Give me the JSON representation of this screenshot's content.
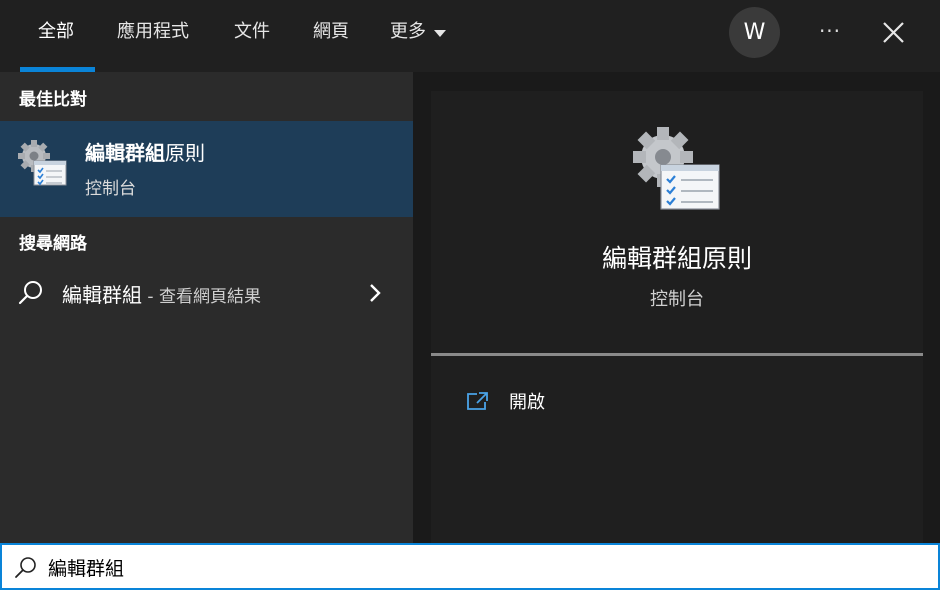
{
  "tabs": {
    "all": "全部",
    "apps": "應用程式",
    "documents": "文件",
    "web": "網頁",
    "more": "更多"
  },
  "header": {
    "avatar_initial": "W",
    "more_label": "···"
  },
  "left": {
    "best_match_title": "最佳比對",
    "best_match": {
      "title_bold": "編輯群組",
      "title_rest": "原則",
      "subtitle": "控制台",
      "icon": "group-policy-gear-icon"
    },
    "web_search_title": "搜尋網路",
    "web_result": {
      "query": "編輯群組",
      "suffix": " - 查看網頁結果"
    }
  },
  "preview": {
    "title": "編輯群組原則",
    "subtitle": "控制台",
    "actions": [
      {
        "label": "開啟",
        "icon": "open-external-icon"
      }
    ]
  },
  "search": {
    "value": "編輯群組"
  },
  "colors": {
    "accent": "#0a84d8",
    "selected_bg": "#1e3d58",
    "panel_bg": "#2b2b2b",
    "preview_bg": "#1f1f1f"
  }
}
